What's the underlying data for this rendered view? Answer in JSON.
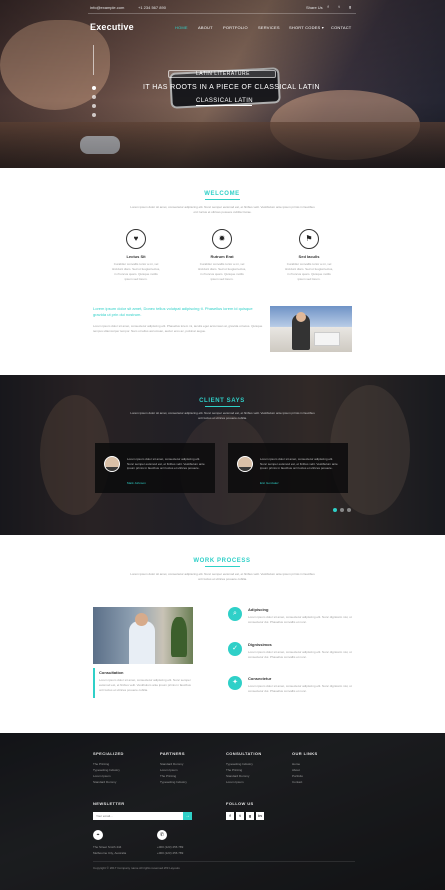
{
  "colors": {
    "accent": "#2fd0c8",
    "dark": "#1d1f24",
    "text": "#555555"
  },
  "topbar": {
    "email": "info@example.com",
    "phone": "+1 234 567 890",
    "share_label": "Share Us",
    "social_icons": [
      "facebook-icon",
      "twitter-icon",
      "google-plus-icon"
    ]
  },
  "brand": "Executive",
  "nav": [
    {
      "label": "HOME",
      "active": true
    },
    {
      "label": "ABOUT",
      "active": false
    },
    {
      "label": "PORTFOLIO",
      "active": false
    },
    {
      "label": "SERVICES",
      "active": false
    },
    {
      "label": "SHORT CODES ▾",
      "active": false
    },
    {
      "label": "CONTACT",
      "active": false
    }
  ],
  "hero": {
    "kicker": "LATIN LITERATURE",
    "title_line1": "IT HAS ROOTS IN A PIECE OF CLASSICAL LATIN",
    "title_line2": "CLASSICAL LATIN"
  },
  "welcome": {
    "heading": "WELCOME",
    "text": "Lorem ipsum dolor sit amet, consectetur adipiscing elit. Nunc semper euismod est, et finibus velit. Vestibulum ante ipsum primis in faucibus orci luctus et ultrices posuere cubilia Curae.",
    "features": [
      {
        "icon": "heart-icon",
        "title": "Lectus Sit",
        "text": "Curabitur convallis tortor a mi, vel tincidunt diam. Sed ut feugiat lectus, in rhoncus quam. Quisque mollis ipsum sed lorem."
      },
      {
        "icon": "sun-icon",
        "title": "Rutrum Erat",
        "text": "Curabitur convallis tortor a mi, vel tincidunt diam. Sed ut feugiat lectus, in rhoncus quam. Quisque mollis ipsum sed lorem."
      },
      {
        "icon": "flag-icon",
        "title": "Sed Iaculis",
        "text": "Curabitur convallis tortor a mi, vel tincidunt diam. Sed ut feugiat lectus, in rhoncus quam. Quisque mollis ipsum sed lorem."
      }
    ],
    "lead": "Lorem ipsum dolor sit amet, Donec tellus volutpat adipiscing ti. Phasellus lorem id quisque gravida ut prin dui nostrum.",
    "body": "Lorem ipsum dolor sit amet, consectetur adipiscing elit. Phasellus lorem mi, iaculis eget accumsan at, gravida ut lacus. Quisque tempus ullamcorper tempor. Nam ut tellus accumsan, auctor eros ac, pulvinar augue."
  },
  "clients": {
    "heading": "CLIENT SAYS",
    "text": "Lorem ipsum dolor sit amet, consectetur adipiscing elit. Nunc semper euismod est, et finibus velit. Vestibulum ante ipsum primis in faucibus orci luctus et ultrices posuere cubilia.",
    "testimonials": [
      {
        "text": "Lorem ipsum dolor sit amet, consectetur adipiscing elit. Nunc semper euismod est, et finibus velit. Vestibulum ante ipsum primis in faucibus orci luctus et ultrices posuere.",
        "name": "Mark Johnson"
      },
      {
        "text": "Lorem ipsum dolor sit amet, consectetur adipiscing elit. Nunc semper euismod est, et finibus velit. Vestibulum ante ipsum primis in faucibus orci luctus et ultrices posuere.",
        "name": "Eric Gonzalez"
      }
    ]
  },
  "process": {
    "heading": "WORK PROCESS",
    "text": "Lorem ipsum dolor sit amet, consectetur adipiscing elit. Nunc semper euismod est, et finibus velit. Vestibulum ante ipsum primis in faucibus orci luctus et ultrices posuere cubilia.",
    "consultation_title": "Consultation",
    "consultation_text": "Lorem ipsum dolor sit amet, consectetur adipiscing elit. Nunc semper euismod est, et finibus velit. Vestibulum ante ipsum primis in faucibus orci luctus et ultrices posuere cubilia.",
    "steps": [
      {
        "icon": "search-icon",
        "title": "Adipiscing",
        "text": "Lorem ipsum dolor sit amet, consectetur adipiscing elit. Nunc dignissim nisi, ut consectetur dui. Phasellus convallis et nunc."
      },
      {
        "icon": "check-icon",
        "title": "Dignissimos",
        "text": "Lorem ipsum dolor sit amet, consectetur adipiscing elit. Nunc dignissim nisi, ut consectetur dui. Phasellus convallis et nunc."
      },
      {
        "icon": "compass-icon",
        "title": "Consectetur",
        "text": "Lorem ipsum dolor sit amet, consectetur adipiscing elit. Nunc dignissim nisi, ut consectetur dui. Phasellus convallis et nunc."
      }
    ]
  },
  "footer": {
    "columns": [
      {
        "title": "SPECIALIZED",
        "links": [
          "The Printing",
          "Typesetting Industry",
          "Lorem Ipsum",
          "Standard Dummy"
        ]
      },
      {
        "title": "PARTNERS",
        "links": [
          "Standard Dummy",
          "Lorem Ipsum",
          "The Printing",
          "Typesetting Industry"
        ]
      },
      {
        "title": "CONSULTATION",
        "links": [
          "Typesetting Industry",
          "The Printing",
          "Standard Dummy",
          "Lorem Ipsum"
        ]
      },
      {
        "title": "OUR LINKS",
        "links": [
          "Home",
          "About",
          "Portfolio",
          "Contact"
        ]
      }
    ],
    "newsletter_title": "NEWSLETTER",
    "newsletter_placeholder": "Your email...",
    "newsletter_submit": "→",
    "follow_title": "FOLLOW US",
    "follow_icons": [
      {
        "icon": "facebook-icon",
        "glyph": "f"
      },
      {
        "icon": "twitter-icon",
        "glyph": "t"
      },
      {
        "icon": "google-plus-icon",
        "glyph": "g"
      },
      {
        "icon": "linkedin-icon",
        "glyph": "in"
      }
    ],
    "address_line1": "The Street Smith 444",
    "address_line2": "Melbourne City, Australia",
    "contact_line1": "+000 (123) 456 789",
    "contact_line2": "+000 (123) 456 789",
    "copyright": "Copyright © 2017 Company name All rights reserved.W3 Layouts"
  }
}
